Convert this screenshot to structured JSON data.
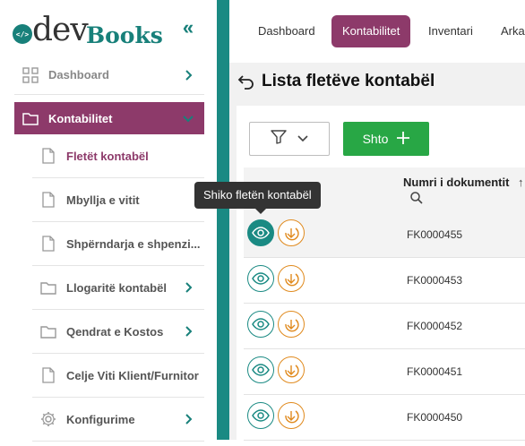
{
  "brand": {
    "mark": "</>",
    "dev": "dev",
    "books": "Books",
    "accent": "#1a8a83",
    "secondary": "#8d3a6a"
  },
  "sidebar": {
    "collapse_label": "«",
    "items": [
      {
        "label": "Dashboard",
        "icon": "grid-icon"
      },
      {
        "label": "Kontabilitet",
        "icon": "folder-icon",
        "active": true
      }
    ],
    "sub_items": [
      {
        "label": "Fletët kontabël",
        "icon": "file-icon",
        "current": true
      },
      {
        "label": "Mbyllja e vitit",
        "icon": "file-icon"
      },
      {
        "label": "Shpërndarja e shpenzi...",
        "icon": "file-icon"
      },
      {
        "label": "Llogaritë kontabël",
        "icon": "folder-icon",
        "chevron": true
      },
      {
        "label": "Qendrat e Kostos",
        "icon": "folder-icon",
        "chevron": true
      },
      {
        "label": "Celje Viti Klient/Furnitor",
        "icon": "file-icon"
      },
      {
        "label": "Konfigurime",
        "icon": "gear-icon",
        "chevron": true
      }
    ]
  },
  "topbar": {
    "tabs": [
      {
        "label": "Dashboard"
      },
      {
        "label": "Kontabilitet",
        "active": true
      },
      {
        "label": "Inventari"
      },
      {
        "label": "Arka"
      }
    ]
  },
  "page": {
    "title": "Lista fletëve kontabël",
    "add_label": "Shto",
    "tooltip": "Shiko fletën kontabël"
  },
  "table": {
    "column": "Numri i dokumentit",
    "sort_icon": "↑",
    "rows": [
      {
        "doc_no": "FK0000455"
      },
      {
        "doc_no": "FK0000453"
      },
      {
        "doc_no": "FK0000452"
      },
      {
        "doc_no": "FK0000451"
      },
      {
        "doc_no": "FK0000450"
      }
    ]
  }
}
